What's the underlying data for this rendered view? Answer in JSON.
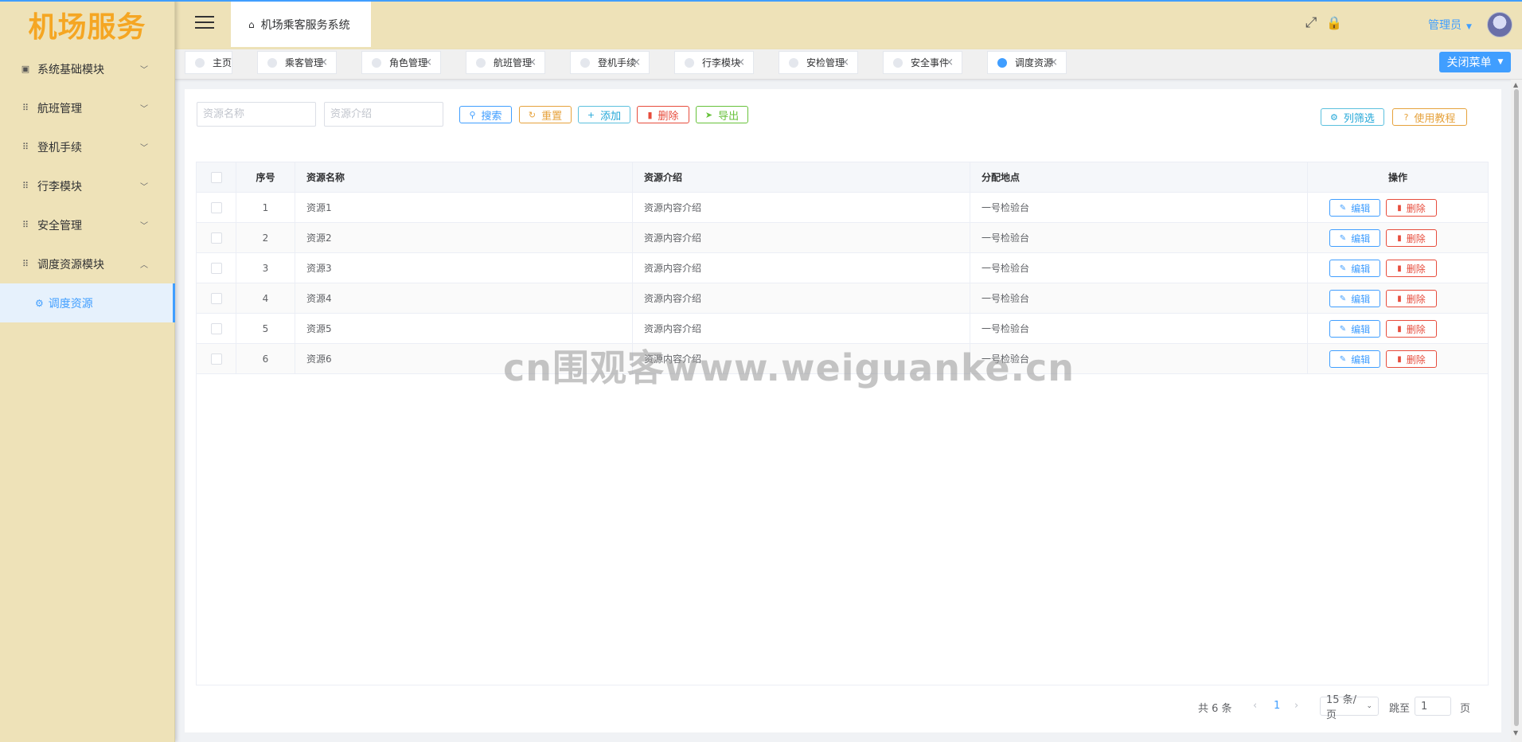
{
  "logo": "机场服务",
  "sidebar": {
    "items": [
      {
        "label": "系统基础模块",
        "icon": "chart-icon",
        "expanded": false
      },
      {
        "label": "航班管理",
        "icon": "grid-icon",
        "expanded": false
      },
      {
        "label": "登机手续",
        "icon": "grid-icon",
        "expanded": false
      },
      {
        "label": "行李模块",
        "icon": "grid-icon",
        "expanded": false
      },
      {
        "label": "安全管理",
        "icon": "grid-icon",
        "expanded": false
      },
      {
        "label": "调度资源模块",
        "icon": "grid-icon",
        "expanded": true
      }
    ],
    "active_sub": {
      "label": "调度资源",
      "icon": "settings-icon"
    }
  },
  "header": {
    "breadcrumb": "机场乘客服务系统",
    "user": "管理员"
  },
  "tabs": [
    {
      "label": "主页",
      "closable": false,
      "active": false
    },
    {
      "label": "乘客管理",
      "closable": true,
      "active": false
    },
    {
      "label": "角色管理",
      "closable": true,
      "active": false
    },
    {
      "label": "航班管理",
      "closable": true,
      "active": false
    },
    {
      "label": "登机手续",
      "closable": true,
      "active": false
    },
    {
      "label": "行李模块",
      "closable": true,
      "active": false
    },
    {
      "label": "安检管理",
      "closable": true,
      "active": false
    },
    {
      "label": "安全事件",
      "closable": true,
      "active": false
    },
    {
      "label": "调度资源",
      "closable": true,
      "active": true
    }
  ],
  "close_menu_label": "关闭菜单",
  "search": {
    "name_placeholder": "资源名称",
    "intro_placeholder": "资源介绍",
    "search_label": "搜索",
    "reset_label": "重置",
    "add_label": "添加",
    "delete_label": "删除",
    "export_label": "导出",
    "filter_label": "列筛选",
    "tutorial_label": "使用教程"
  },
  "table": {
    "columns": [
      "序号",
      "资源名称",
      "资源介绍",
      "分配地点",
      "操作"
    ],
    "rows": [
      [
        "1",
        "资源1",
        "资源内容介绍",
        "一号检验台"
      ],
      [
        "2",
        "资源2",
        "资源内容介绍",
        "一号检验台"
      ],
      [
        "3",
        "资源3",
        "资源内容介绍",
        "一号检验台"
      ],
      [
        "4",
        "资源4",
        "资源内容介绍",
        "一号检验台"
      ],
      [
        "5",
        "资源5",
        "资源内容介绍",
        "一号检验台"
      ],
      [
        "6",
        "资源6",
        "资源内容介绍",
        "一号检验台"
      ]
    ],
    "edit_label": "编辑",
    "delete_label": "删除"
  },
  "pagination": {
    "total": "共 6 条",
    "current_page": "1",
    "page_size": "15 条/页",
    "jump_label": "跳至",
    "jump_value": "1",
    "page_suffix": "页"
  },
  "watermark": "cn围观客www.weiguanke.cn",
  "colors": {
    "primary": "#409eff",
    "sidebar_bg": "#eee2b8",
    "logo": "#f5a623",
    "danger": "#e74c3c",
    "warning": "#e6a23c",
    "success": "#67c23a"
  }
}
